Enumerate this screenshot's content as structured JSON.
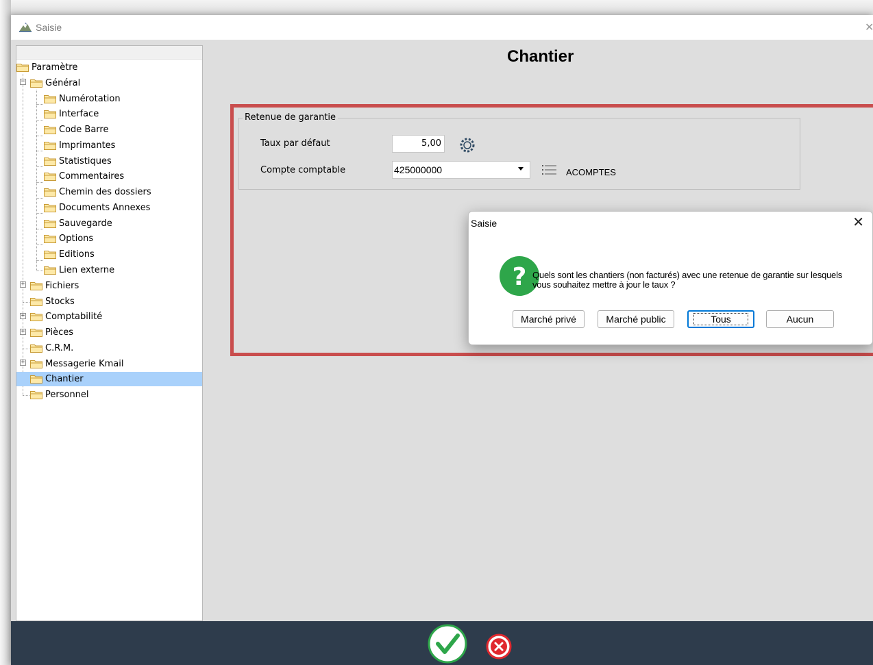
{
  "window": {
    "title": "Saisie"
  },
  "page_title": "Chantier",
  "tree": {
    "items": [
      {
        "label": "Paramètre"
      },
      {
        "label": "Général"
      },
      {
        "label": "Numérotation"
      },
      {
        "label": "Interface"
      },
      {
        "label": "Code Barre"
      },
      {
        "label": "Imprimantes"
      },
      {
        "label": "Statistiques"
      },
      {
        "label": "Commentaires"
      },
      {
        "label": "Chemin des dossiers"
      },
      {
        "label": "Documents Annexes"
      },
      {
        "label": "Sauvegarde"
      },
      {
        "label": "Options"
      },
      {
        "label": "Editions"
      },
      {
        "label": "Lien externe"
      },
      {
        "label": "Fichiers"
      },
      {
        "label": "Stocks"
      },
      {
        "label": "Comptabilité"
      },
      {
        "label": "Pièces"
      },
      {
        "label": "C.R.M."
      },
      {
        "label": "Messagerie Kmail"
      },
      {
        "label": "Chantier"
      },
      {
        "label": "Personnel"
      }
    ],
    "selected": "Chantier"
  },
  "retenue": {
    "group_label": "Retenue de garantie",
    "rate_label": "Taux par défaut",
    "rate_value": "5,00",
    "account_label": "Compte comptable",
    "account_value": "425000000",
    "account_name": "ACOMPTES"
  },
  "dialog": {
    "title": "Saisie",
    "message_line1": "Quels sont les chantiers (non facturés) avec une retenue de garantie sur lesquels",
    "message_line2": "vous souhaitez mettre à jour le taux ?",
    "buttons": {
      "prive": "Marché privé",
      "public": "Marché public",
      "tous": "Tous",
      "aucun": "Aucun"
    }
  },
  "colors": {
    "highlight_border": "#c94d4d",
    "selection": "#a9d1fb",
    "bottom_bar": "#2e3c4c",
    "ok_green": "#2ea64a",
    "cancel_red": "#e0282e"
  },
  "icons": {
    "app": "landscape-icon",
    "gear": "gear-icon",
    "list": "list-icon",
    "question": "question-icon",
    "ok": "checkmark-icon",
    "cancel": "cancel-icon"
  }
}
